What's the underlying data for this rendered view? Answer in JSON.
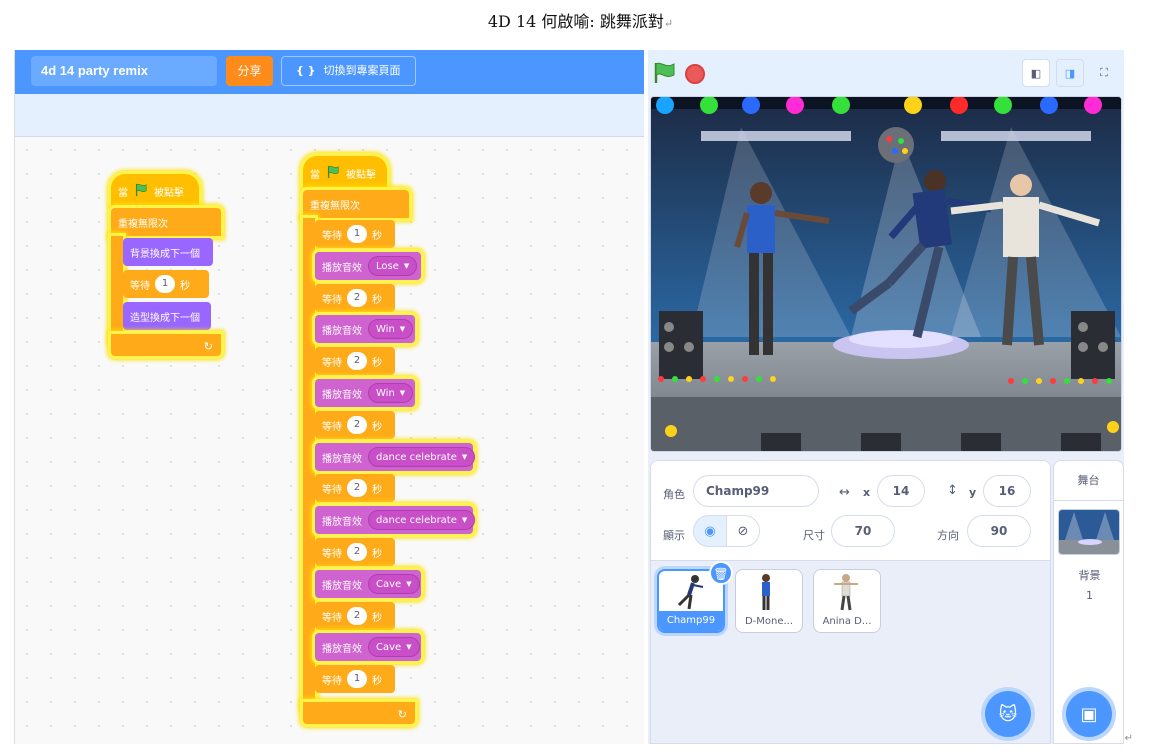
{
  "document": {
    "title": "4D 14 何啟喻: 跳舞派對"
  },
  "menubar": {
    "project_title": "4d 14 party remix",
    "share_label": "分享",
    "see_project_label": "切換到專案頁面"
  },
  "scripts": {
    "script1": {
      "hat_prefix": "當",
      "hat_suffix": "被點擊",
      "forever": "重複無限次",
      "next_backdrop": "背景換成下一個",
      "wait_label": "等待",
      "wait_value": "1",
      "wait_unit": "秒",
      "next_costume": "造型換成下一個"
    },
    "script2": {
      "hat_prefix": "當",
      "hat_suffix": "被點擊",
      "forever": "重複無限次",
      "wait_label": "等待",
      "wait_unit": "秒",
      "sound_label": "播放音效",
      "steps": [
        {
          "kind": "wait",
          "value": "1"
        },
        {
          "kind": "sound",
          "value": "Lose"
        },
        {
          "kind": "wait",
          "value": "2"
        },
        {
          "kind": "sound",
          "value": "Win"
        },
        {
          "kind": "wait",
          "value": "2"
        },
        {
          "kind": "sound",
          "value": "Win"
        },
        {
          "kind": "wait",
          "value": "2"
        },
        {
          "kind": "sound",
          "value": "dance celebrate"
        },
        {
          "kind": "wait",
          "value": "2"
        },
        {
          "kind": "sound",
          "value": "dance celebrate"
        },
        {
          "kind": "wait",
          "value": "2"
        },
        {
          "kind": "sound",
          "value": "Cave"
        },
        {
          "kind": "wait",
          "value": "2"
        },
        {
          "kind": "sound",
          "value": "Cave"
        },
        {
          "kind": "wait",
          "value": "1"
        }
      ]
    }
  },
  "sprite_info": {
    "sprite_label": "角色",
    "sprite_name": "Champ99",
    "x_label": "x",
    "x_value": "14",
    "y_label": "y",
    "y_value": "16",
    "show_label": "顯示",
    "size_label": "尺寸",
    "size_value": "70",
    "direction_label": "方向",
    "direction_value": "90"
  },
  "sprites": [
    {
      "name": "Champ99",
      "selected": true
    },
    {
      "name": "D-Mone...",
      "selected": false
    },
    {
      "name": "Anina D...",
      "selected": false
    }
  ],
  "stage_pane": {
    "header": "舞台",
    "backdrops_label": "背景",
    "backdrops_count": "1"
  },
  "colors": {
    "menubar": "#4c97ff",
    "events": "#ffbf00",
    "control": "#ffab19",
    "looks": "#9966ff",
    "sound": "#cf63cf",
    "share": "#ff8c1a"
  },
  "icons": [
    "green-flag-icon",
    "stop-icon",
    "small-stage-icon",
    "large-stage-icon",
    "fullscreen-icon",
    "show-eye-icon",
    "hide-icon",
    "delete-icon",
    "choose-sprite-icon",
    "choose-backdrop-icon",
    "x-arrows-icon",
    "y-arrows-icon",
    "see-project-icon"
  ]
}
